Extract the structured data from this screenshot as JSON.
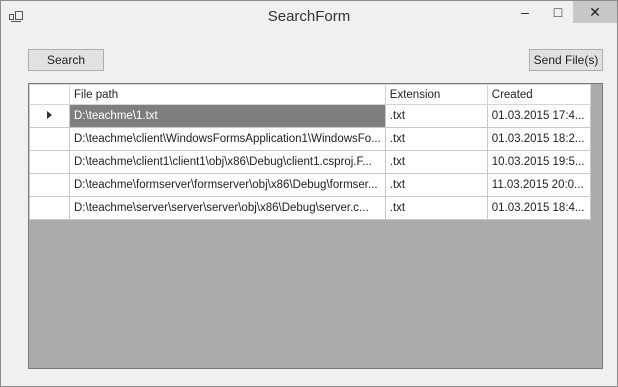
{
  "window": {
    "title": "SearchForm",
    "minimize": "–",
    "maximize": "□",
    "close": "✕"
  },
  "toolbar": {
    "search_label": "Search",
    "send_label": "Send File(s)"
  },
  "grid": {
    "columns": [
      "File path",
      "Extension",
      "Created"
    ],
    "rows": [
      {
        "path": "D:\\teachme\\1.txt",
        "ext": ".txt",
        "created": "01.03.2015 17:4..."
      },
      {
        "path": "D:\\teachme\\client\\WindowsFormsApplication1\\WindowsFo...",
        "ext": ".txt",
        "created": "01.03.2015 18:2..."
      },
      {
        "path": "D:\\teachme\\client1\\client1\\obj\\x86\\Debug\\client1.csproj.F...",
        "ext": ".txt",
        "created": "10.03.2015 19:5..."
      },
      {
        "path": "D:\\teachme\\formserver\\formserver\\obj\\x86\\Debug\\formser...",
        "ext": ".txt",
        "created": "11.03.2015 20:0..."
      },
      {
        "path": "D:\\teachme\\server\\server\\server\\obj\\x86\\Debug\\server.c...",
        "ext": ".txt",
        "created": "01.03.2015 18:4..."
      }
    ],
    "selected_row": 0
  }
}
